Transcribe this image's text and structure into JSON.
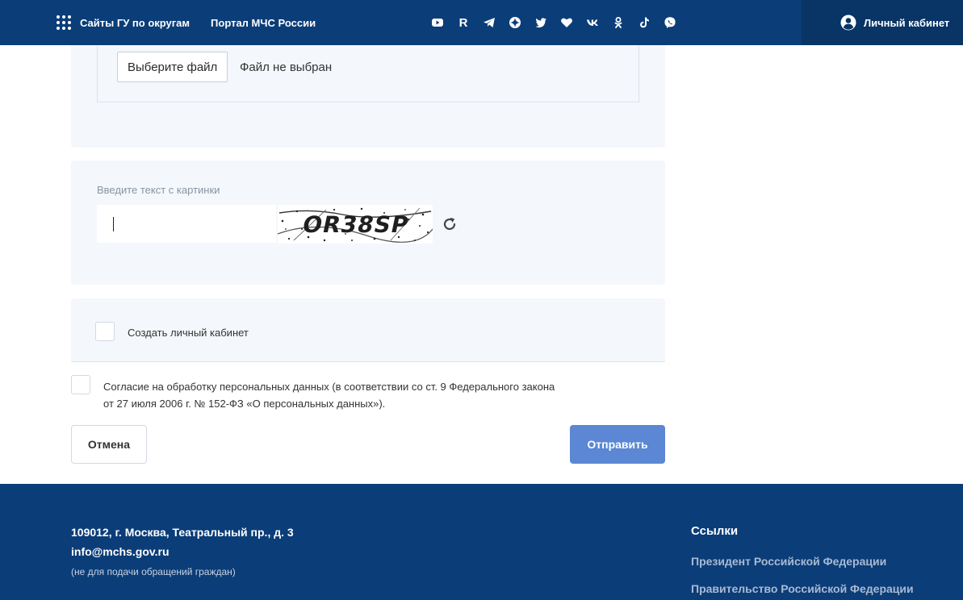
{
  "header": {
    "sites_label": "Сайты ГУ по округам",
    "portal_label": "Портал МЧС России",
    "socials": [
      "youtube-icon",
      "rutube-icon",
      "telegram-icon",
      "odnoklassniki-dzen-icon",
      "twitter-icon",
      "heart-icon",
      "vk-icon",
      "ok-icon",
      "tiktok-icon",
      "viber-icon"
    ],
    "rutube_letter": "R",
    "cabinet_label": "Личный кабинет"
  },
  "file": {
    "button_label": "Выберите файл",
    "status": "Файл не выбран"
  },
  "captcha": {
    "label": "Введите текст с картинки",
    "input_value": "",
    "image_text": "OR38SP"
  },
  "register": {
    "label": "Создать личный кабинет",
    "checked": false
  },
  "consent": {
    "text_line1": "Согласие на обработку персональных данных (в соответствии со ст. 9 Федерального закона",
    "text_line2": "от 27 июля 2006 г. № 152-ФЗ «О персональных данных»).",
    "checked": false
  },
  "actions": {
    "cancel_label": "Отмена",
    "submit_label": "Отправить"
  },
  "footer": {
    "address": "109012, г. Москва, Театральный пр., д. 3",
    "email": "info@mchs.gov.ru",
    "note": "(не для подачи обращений граждан)",
    "links_title": "Ссылки",
    "links": [
      "Президент Российской Федерации",
      "Правительство Российской Федерации"
    ]
  },
  "colors": {
    "header_bg": "#0b3d78",
    "cabinet_bg": "#083466",
    "panel_bg": "#f4f7fc",
    "submit_bg": "#5b87d4",
    "footer_link": "#a9bad3"
  }
}
